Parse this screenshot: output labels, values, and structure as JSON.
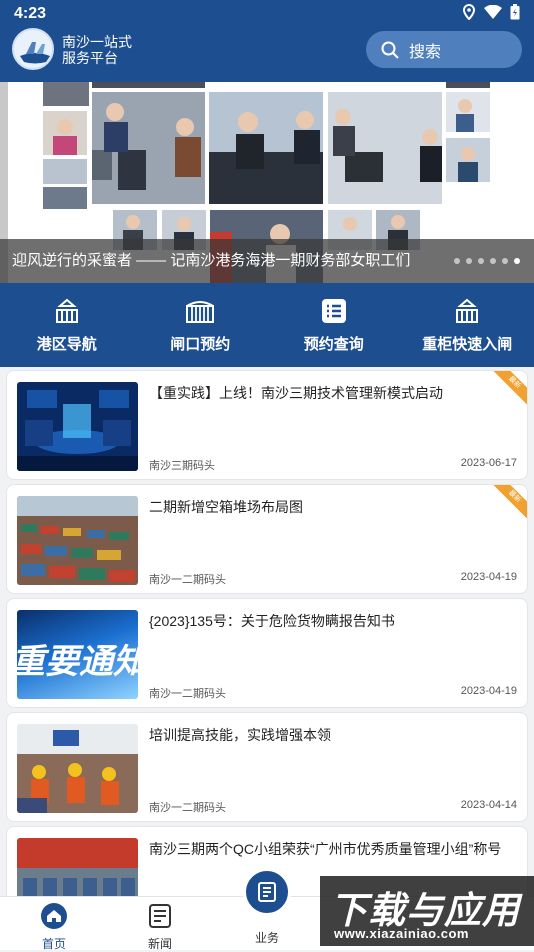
{
  "status_bar": {
    "time": "4:23"
  },
  "header": {
    "brand_line1": "南沙一站式",
    "brand_line2": "服务平台",
    "search_label": "搜索"
  },
  "banner": {
    "caption": "迎风逆行的采蜜者 —— 记南沙港务海港一期财务部女职工们",
    "slide_count": 6,
    "active_slide": 6
  },
  "quick_nav": [
    {
      "label": "港区导航",
      "icon": "port-crane-icon"
    },
    {
      "label": "闸口预约",
      "icon": "gate-icon"
    },
    {
      "label": "预约查询",
      "icon": "list-icon"
    },
    {
      "label": "重柜快速入闸",
      "icon": "port-crane-icon"
    }
  ],
  "news": [
    {
      "title": "【重实践】上线！南沙三期技术管理新模式启动",
      "source": "南沙三期码头",
      "date": "2023-06-17",
      "badge": "最新"
    },
    {
      "title": "二期新增空箱堆场布局图",
      "source": "南沙一二期码头",
      "date": "2023-04-19",
      "badge": "最新"
    },
    {
      "title": "{2023}135号：关于危险货物瞒报告知书",
      "source": "南沙一二期码头",
      "date": "2023-04-19",
      "thumb_text": "重要通知"
    },
    {
      "title": "培训提高技能，实践增强本领",
      "source": "南沙一二期码头",
      "date": "2023-04-14"
    },
    {
      "title": "南沙三期两个QC小组荣获“广州市优秀质量管理小组”称号",
      "source": "",
      "date": ""
    }
  ],
  "tabbar": {
    "home": "首页",
    "news": "新闻",
    "business": "业务"
  },
  "watermark": {
    "big": "下载与应用",
    "small": "www.xiazainiao.com"
  },
  "colors": {
    "primary": "#1d4e8f",
    "badge": "#f0a12f"
  }
}
